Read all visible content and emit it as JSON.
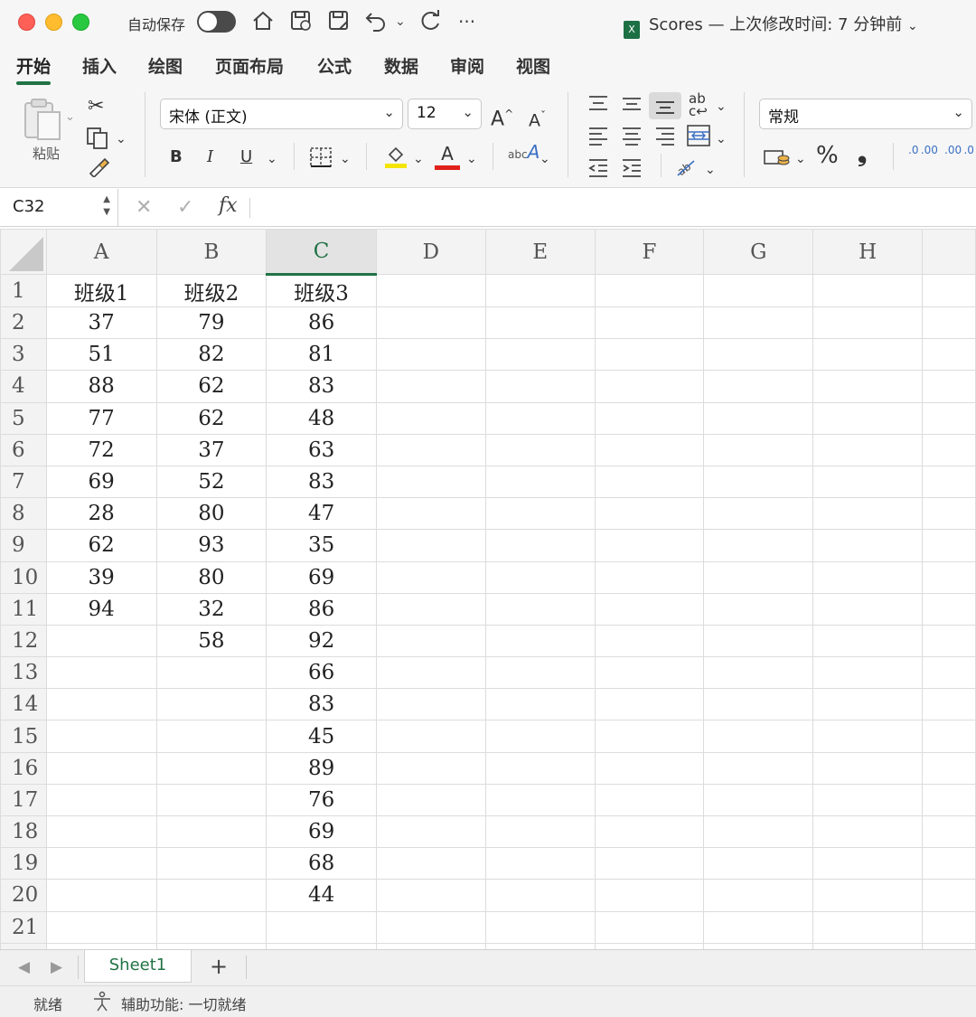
{
  "titlebar": {
    "autosave_label": "自动保存",
    "doc_name": "Scores",
    "doc_status": "— 上次修改时间: 7 分钟前",
    "excel_badge": "X"
  },
  "tabs": [
    "开始",
    "插入",
    "绘图",
    "页面布局",
    "公式",
    "数据",
    "审阅",
    "视图"
  ],
  "ribbon": {
    "paste_label": "粘贴",
    "font_name": "宋体 (正文)",
    "font_size": "12",
    "number_format": "常规",
    "bold": "B",
    "italic": "I",
    "underline": "U",
    "grow_font": "A",
    "shrink_font": "A",
    "percent": "%",
    "comma": "❟",
    "font_color_letter": "A",
    "orientation_label": "abc",
    "inc_decimal": ".0 .00",
    "dec_decimal": ".00 .0"
  },
  "formula_bar": {
    "cell_ref": "C32",
    "fx": "fx",
    "formula": ""
  },
  "columns": [
    "A",
    "B",
    "C",
    "D",
    "E",
    "F",
    "G",
    "H"
  ],
  "rows": [
    [
      "班级1",
      "班级2",
      "班级3",
      "",
      "",
      "",
      "",
      ""
    ],
    [
      "37",
      "79",
      "86",
      "",
      "",
      "",
      "",
      ""
    ],
    [
      "51",
      "82",
      "81",
      "",
      "",
      "",
      "",
      ""
    ],
    [
      "88",
      "62",
      "83",
      "",
      "",
      "",
      "",
      ""
    ],
    [
      "77",
      "62",
      "48",
      "",
      "",
      "",
      "",
      ""
    ],
    [
      "72",
      "37",
      "63",
      "",
      "",
      "",
      "",
      ""
    ],
    [
      "69",
      "52",
      "83",
      "",
      "",
      "",
      "",
      ""
    ],
    [
      "28",
      "80",
      "47",
      "",
      "",
      "",
      "",
      ""
    ],
    [
      "62",
      "93",
      "35",
      "",
      "",
      "",
      "",
      ""
    ],
    [
      "39",
      "80",
      "69",
      "",
      "",
      "",
      "",
      ""
    ],
    [
      "94",
      "32",
      "86",
      "",
      "",
      "",
      "",
      ""
    ],
    [
      "",
      "58",
      "92",
      "",
      "",
      "",
      "",
      ""
    ],
    [
      "",
      "",
      "66",
      "",
      "",
      "",
      "",
      ""
    ],
    [
      "",
      "",
      "83",
      "",
      "",
      "",
      "",
      ""
    ],
    [
      "",
      "",
      "45",
      "",
      "",
      "",
      "",
      ""
    ],
    [
      "",
      "",
      "89",
      "",
      "",
      "",
      "",
      ""
    ],
    [
      "",
      "",
      "76",
      "",
      "",
      "",
      "",
      ""
    ],
    [
      "",
      "",
      "69",
      "",
      "",
      "",
      "",
      ""
    ],
    [
      "",
      "",
      "68",
      "",
      "",
      "",
      "",
      ""
    ],
    [
      "",
      "",
      "44",
      "",
      "",
      "",
      "",
      ""
    ],
    [
      "",
      "",
      "",
      "",
      "",
      "",
      "",
      ""
    ],
    [
      "",
      "",
      "",
      "",
      "",
      "",
      "",
      ""
    ]
  ],
  "selected_column": "C",
  "sheets": {
    "active": "Sheet1",
    "add_label": "+"
  },
  "status": {
    "ready": "就绪",
    "accessibility": "辅助功能: 一切就绪"
  },
  "colors": {
    "accent": "#217346",
    "font_color_bar": "#e0201a",
    "highlight_bar": "#f4e400"
  }
}
